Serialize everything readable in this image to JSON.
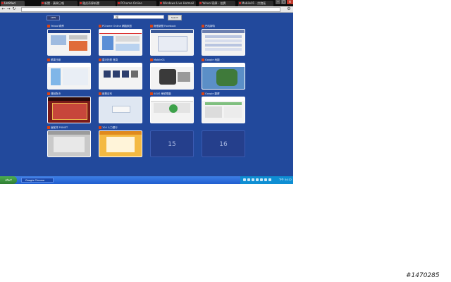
{
  "browser": {
    "tabs": [
      {
        "label": "Untitled"
      },
      {
        "label": "新聞 - 蘋果日報"
      },
      {
        "label": "雅虎奇摩新聞"
      },
      {
        "label": "PChome Online"
      },
      {
        "label": "Windows Live Hotmail"
      },
      {
        "label": "Yahoo!奇摩 - 拍賣"
      },
      {
        "label": "Mobile01 - 討論區"
      }
    ]
  },
  "ntp": {
    "apps_label": "APPS",
    "search_value": "搜",
    "search_button": "Search",
    "thumbnails": [
      {
        "title": "Yahoo!奇摩"
      },
      {
        "title": "PChome Online 網路家庭"
      },
      {
        "title": "財經新聞 Facebook"
      },
      {
        "title": "巴哈姆特"
      },
      {
        "title": "蘋果日報"
      },
      {
        "title": "露天拍賣 首頁"
      },
      {
        "title": "Mobile01"
      },
      {
        "title": "Google 地圖"
      },
      {
        "title": "傳說對決"
      },
      {
        "title": "維基百科"
      },
      {
        "title": "ASUS 華碩電腦"
      },
      {
        "title": "Google 翻譯"
      },
      {
        "title": "痞客邦 PIXNET"
      },
      {
        "title": "104 人力銀行"
      },
      {
        "number": "15"
      },
      {
        "number": "16"
      }
    ]
  },
  "taskbar": {
    "start_label": "start",
    "task_label": "Google Chrome",
    "clock": "下午 04:12"
  },
  "watermark": "#1470285"
}
